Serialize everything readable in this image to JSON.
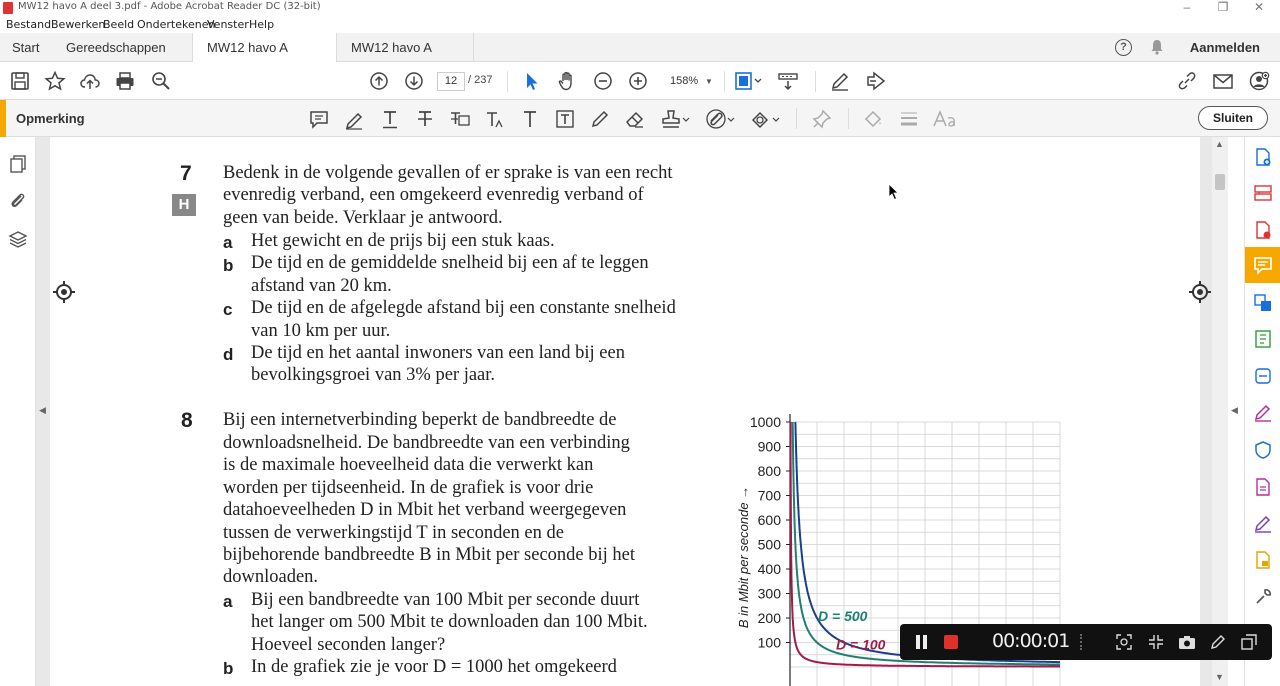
{
  "window": {
    "title": "MW12 havo A deel 3.pdf - Adobe Acrobat Reader DC (32-bit)"
  },
  "menu": [
    "Bestand",
    "Bewerken",
    "Beeld",
    "Ondertekenen",
    "Venster",
    "Help"
  ],
  "tabs": {
    "home": "Start",
    "tools": "Gereedschappen",
    "doc1": "MW12 havo A deel...",
    "doc1_close": "×",
    "doc2": "MW12 havo A deel..."
  },
  "header": {
    "signin": "Aanmelden",
    "help_glyph": "?"
  },
  "toolbar": {
    "page_current": "12",
    "page_total": "/ 237",
    "zoom": "158%"
  },
  "comment_toolbar": {
    "label": "Opmerking",
    "close": "Sluiten"
  },
  "document": {
    "q7": {
      "number": "7",
      "badge": "H",
      "lines": [
        "Bedenk in de volgende gevallen of er sprake is van een recht",
        "evenredig verband, een omgekeerd evenredig verband of",
        "geen van beide. Verklaar je antwoord."
      ],
      "items": [
        {
          "label": "a",
          "lines": [
            "Het gewicht en de prijs bij een stuk kaas."
          ]
        },
        {
          "label": "b",
          "lines": [
            "De tijd en de gemiddelde snelheid bij een af te leggen",
            "afstand van 20 km."
          ]
        },
        {
          "label": "c",
          "lines": [
            "De tijd en de afgelegde afstand bij een constante snelheid",
            "van 10 km per uur."
          ]
        },
        {
          "label": "d",
          "lines": [
            "De tijd en het aantal inwoners van een land bij een",
            "bevolkingsgroei van 3% per jaar."
          ]
        }
      ]
    },
    "q8": {
      "number": "8",
      "lines": [
        "Bij een internetverbinding beperkt de bandbreedte de",
        "downloadsnelheid. De bandbreedte van een verbinding",
        "is de maximale hoeveelheid data die verwerkt kan",
        "worden per tijdseenheid. In de grafiek is voor drie",
        "datahoeveelheden D in Mbit het verband weergegeven",
        "tussen de verwerkingstijd T in seconden en de",
        "bijbehorende bandbreedte B in Mbit per seconde bij het",
        "downloaden."
      ],
      "items": [
        {
          "label": "a",
          "lines": [
            "Bij een bandbreedte van 100 Mbit per seconde duurt",
            "het langer om 500 Mbit te downloaden dan 100 Mbit.",
            "Hoeveel seconden langer?"
          ]
        },
        {
          "label": "b",
          "lines": [
            "In de grafiek zie je voor D = 1000 het omgekeerd"
          ]
        }
      ]
    }
  },
  "chart_data": {
    "type": "line",
    "ylabel": "B in Mbit per seconde →",
    "y_ticks": [
      100,
      200,
      300,
      400,
      500,
      600,
      700,
      800,
      900,
      1000
    ],
    "ylim": [
      0,
      1000
    ],
    "xlim": [
      0,
      50
    ],
    "grid": true,
    "series": [
      {
        "name": "D = 100",
        "color": "#a31a4a",
        "values_rule": "B = 100 / T"
      },
      {
        "name": "D = 500",
        "color": "#1e8070",
        "values_rule": "B = 500 / T"
      },
      {
        "name": "",
        "color": "#1a3f8a",
        "values_rule": "B = 1000 / T"
      }
    ],
    "annotations": [
      "D = 500",
      "D = 100"
    ]
  },
  "recorder": {
    "time": "00:00:01"
  },
  "colors": {
    "accent": "#f5a800",
    "recorder_stop": "#e0302a",
    "link_blue": "#1a6fd8"
  }
}
